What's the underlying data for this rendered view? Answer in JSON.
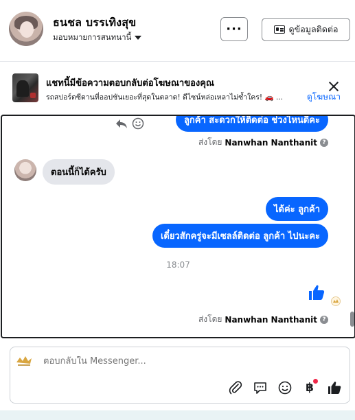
{
  "header": {
    "name": "ธนชล บรรเทิงสุข",
    "assign_label": "มอบหมายการสนทนานี้",
    "more_label": "···",
    "contact_label": "ดูข้อมูลติดต่อ"
  },
  "ad_banner": {
    "title": "แชทนี้มีข้อความตอบกลับต่อโฆษณาของคุณ",
    "description": "รถสปอร์ตซีดานที่ออปชันเยอะที่สุดในตลาด! ดีไซน์หล่อเหลาไม่ซ้ำใคร! 🚗 ...",
    "link_label": "ดูโฆษณา"
  },
  "conversation": {
    "messages": [
      {
        "from": "page",
        "text": "ลูกค้า สะดวกให้ติดต่อ ช่วงไหนดีคะ"
      },
      {
        "from": "customer",
        "text": "ตอนนี้ก็ได้ครับ"
      },
      {
        "from": "page",
        "text": "ได้ค่ะ  ลูกค้า"
      },
      {
        "from": "page",
        "text": "เดี๋ยวสักครู่จะมีเซลล์ติดต่อ ลูกค้า  ไปนะคะ"
      }
    ],
    "sent_by_prefix": "ส่งโดย",
    "sent_by_name": "Nanwhan Nanthanit",
    "timestamp": "18:07",
    "help_glyph": "?"
  },
  "composer": {
    "placeholder": "ตอบกลับใน Messenger...",
    "baht_glyph": "฿"
  },
  "colors": {
    "accent": "#0866ff",
    "bubble_in": "#e4e6eb",
    "notification": "#f02849"
  }
}
